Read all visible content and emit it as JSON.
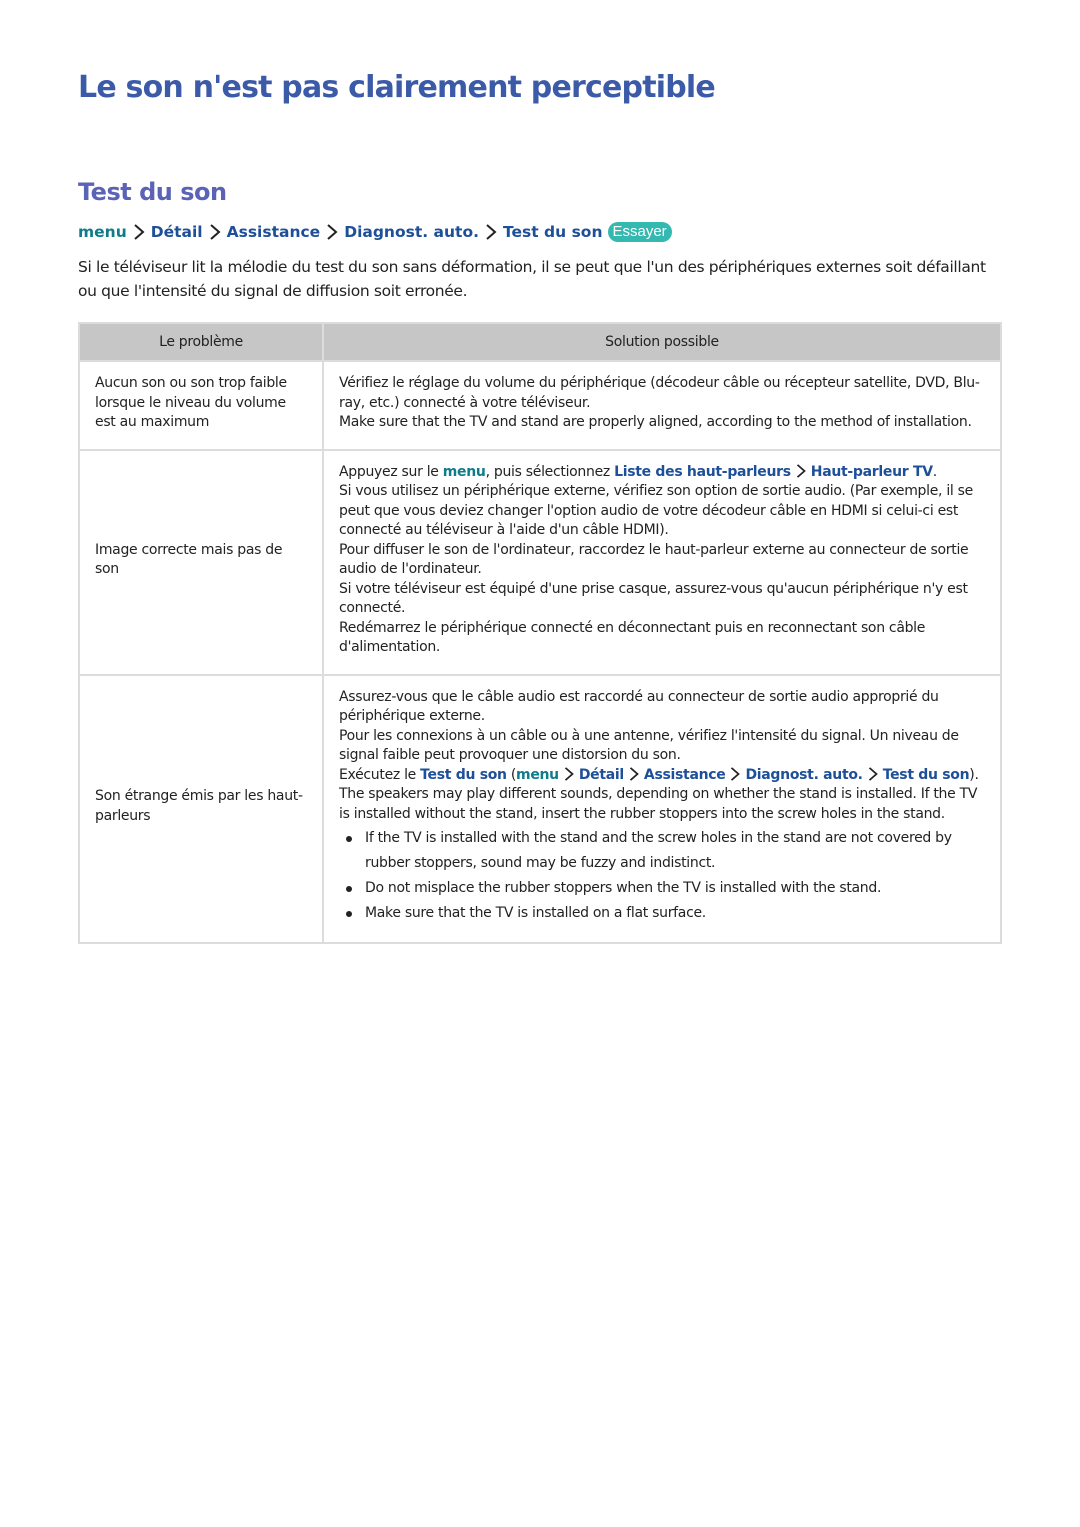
{
  "page": {
    "title": "Le son n'est pas clairement perceptible",
    "section_title": "Test du son"
  },
  "breadcrumb": {
    "items": [
      "menu",
      "Détail",
      "Assistance",
      "Diagnost. auto.",
      "Test du son"
    ],
    "separator_icon": "chevron-right-icon",
    "try_badge": "Essayer"
  },
  "intro": "Si le téléviseur lit la mélodie du test du son sans déformation, il se peut que l'un des périphériques externes soit défaillant ou que l'intensité du signal de diffusion soit erronée.",
  "table": {
    "headers": [
      "Le problème",
      "Solution possible"
    ],
    "rows": [
      {
        "problem": "Aucun son ou son trop faible lorsque le niveau du volume est au maximum",
        "solution": [
          "Vérifiez le réglage du volume du périphérique (décodeur câble ou récepteur satellite, DVD, Blu-ray, etc.) connecté à votre téléviseur.",
          "Make sure that the TV and stand are properly aligned, according to the method of installation."
        ]
      },
      {
        "problem": "Image correcte mais pas de son",
        "solution_first": {
          "prefix": "Appuyez sur le ",
          "menu": "menu",
          "middle": ", puis sélectionnez ",
          "link1": "Liste des haut-parleurs",
          "link2": "Haut-parleur TV",
          "suffix": "."
        },
        "solution": [
          "Si vous utilisez un périphérique externe, vérifiez son option de sortie audio. (Par exemple, il se peut que vous deviez changer l'option audio de votre décodeur câble en HDMI si celui-ci est connecté au téléviseur à l'aide d'un câble HDMI).",
          "Pour diffuser le son de l'ordinateur, raccordez le haut-parleur externe au connecteur de sortie audio de l'ordinateur.",
          "Si votre téléviseur est équipé d'une prise casque, assurez-vous qu'aucun périphérique n'y est connecté.",
          "Redémarrez le périphérique connecté en déconnectant puis en reconnectant son câble d'alimentation."
        ]
      },
      {
        "problem": "Son étrange émis par les haut-parleurs",
        "solution_before": [
          "Assurez-vous que le câble audio est raccordé au connecteur de sortie audio approprié du périphérique externe.",
          "Pour les connexions à un câble ou à une antenne, vérifiez l'intensité du signal. Un niveau de signal faible peut provoquer une distorsion du son."
        ],
        "run_test": {
          "prefix": "Exécutez le ",
          "link": "Test du son",
          "open": " (",
          "path": [
            "menu",
            "Détail",
            "Assistance",
            "Diagnost. auto.",
            "Test du son"
          ],
          "close": ")."
        },
        "solution_after": "The speakers may play different sounds, depending on whether the stand is installed. If the TV is installed without the stand, insert the rubber stoppers into the screw holes in the stand.",
        "bullets": [
          "If the TV is installed with the stand and the screw holes in the stand are not covered by rubber stoppers, sound may be fuzzy and indistinct.",
          "Do not misplace the rubber stoppers when the TV is installed with the stand.",
          "Make sure that the TV is installed on a flat surface."
        ]
      }
    ]
  },
  "colors": {
    "title": "#3b5aa8",
    "section_title": "#5b63b7",
    "link": "#1e4f99",
    "menu_link": "#0f7c8c",
    "badge": "#33b9b0",
    "table_header": "#c6c6c6",
    "table_border": "#dcdcdc"
  }
}
